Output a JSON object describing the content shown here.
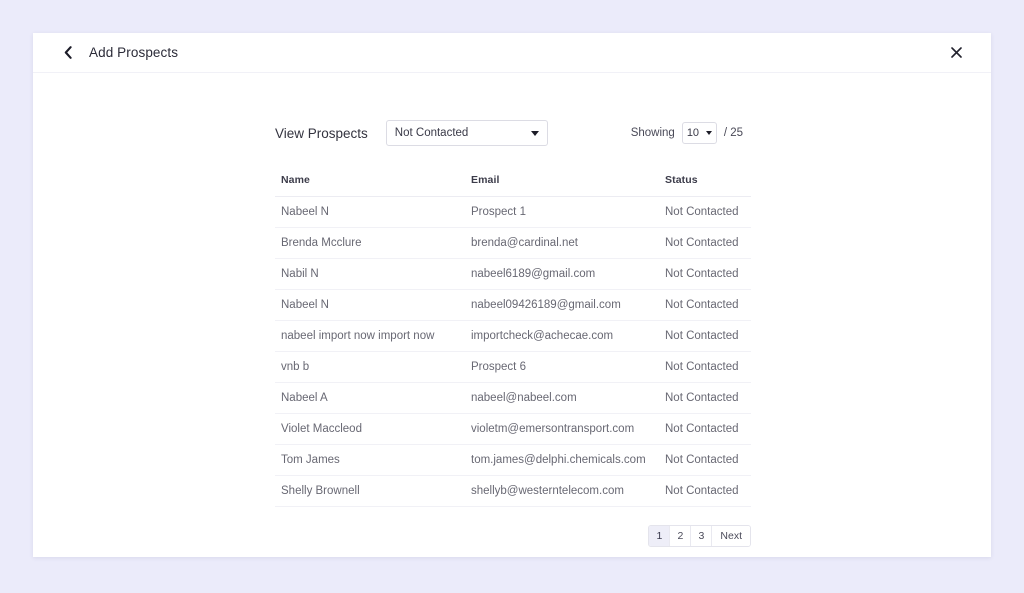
{
  "header": {
    "back_icon": "chevron-left-icon",
    "title": "Add Prospects",
    "close_icon": "close-icon"
  },
  "filter": {
    "label": "View Prospects",
    "selected": "Not Contacted",
    "caret_icon": "chevron-down-icon"
  },
  "paging_summary": {
    "showing_label": "Showing",
    "page_size": "10",
    "caret_icon": "chevron-down-icon",
    "total_label": "/ 25"
  },
  "table": {
    "columns": [
      "Name",
      "Email",
      "Status"
    ],
    "rows": [
      {
        "name": "Nabeel N",
        "email": "Prospect 1",
        "status": "Not Contacted"
      },
      {
        "name": "Brenda Mcclure",
        "email": "brenda@cardinal.net",
        "status": "Not Contacted"
      },
      {
        "name": "Nabil N",
        "email": "nabeel6189@gmail.com",
        "status": "Not Contacted"
      },
      {
        "name": "Nabeel N",
        "email": "nabeel09426189@gmail.com",
        "status": "Not Contacted"
      },
      {
        "name": "nabeel import now import now",
        "email": "importcheck@achecae.com",
        "status": "Not Contacted"
      },
      {
        "name": "vnb b",
        "email": "Prospect 6",
        "status": "Not Contacted"
      },
      {
        "name": "Nabeel A",
        "email": "nabeel@nabeel.com",
        "status": "Not Contacted"
      },
      {
        "name": "Violet Maccleod",
        "email": "violetm@emersontransport.com",
        "status": "Not Contacted"
      },
      {
        "name": "Tom James",
        "email": "tom.james@delphi.chemicals.com",
        "status": "Not Contacted"
      },
      {
        "name": "Shelly Brownell",
        "email": "shellyb@westerntelecom.com",
        "status": "Not Contacted"
      }
    ]
  },
  "pagination": {
    "pages": [
      "1",
      "2",
      "3"
    ],
    "active": "1",
    "next_label": "Next"
  },
  "colors": {
    "page_background": "#ebebfa",
    "surface": "#ffffff",
    "active_page_background": "#eeeef8",
    "text_primary": "#2b2b38",
    "text_secondary": "#686873",
    "border": "#e4e4ec"
  }
}
